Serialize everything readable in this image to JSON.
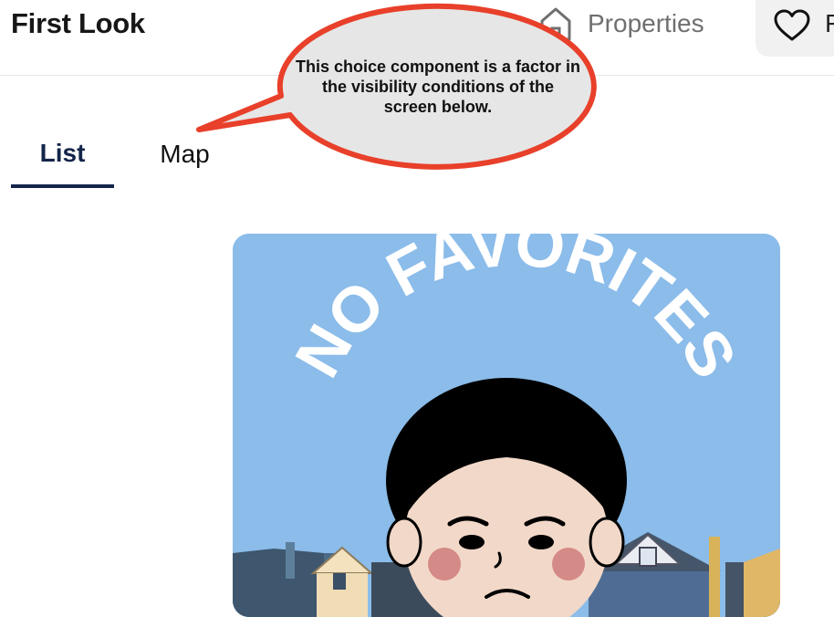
{
  "header": {
    "app_title": "First Look",
    "nav": [
      {
        "label": "Properties",
        "icon": "home-icon"
      },
      {
        "label": "Favorites",
        "icon": "heart-icon"
      }
    ]
  },
  "tabs": [
    {
      "label": "List",
      "selected": true
    },
    {
      "label": "Map",
      "selected": false
    }
  ],
  "callout": {
    "text": "This choice component is a factor in the visibility conditions of the screen below."
  },
  "empty_state": {
    "image_text": "NO FAVORITES",
    "colors": {
      "sky": "#8bbcea",
      "accent_tab": "#14254a",
      "callout_border": "#e8402a",
      "callout_fill": "#e6e6e6"
    }
  }
}
